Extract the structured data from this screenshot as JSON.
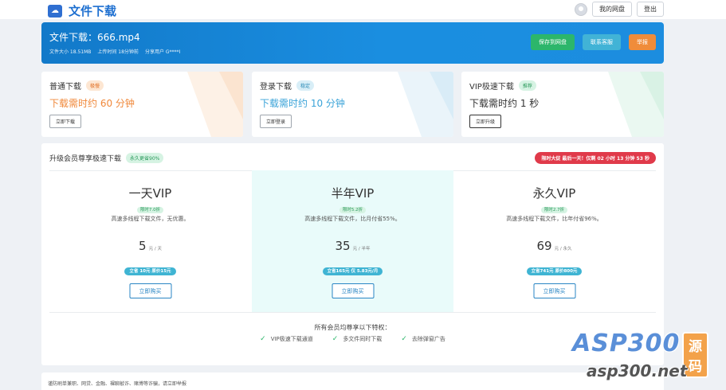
{
  "header": {
    "title": "文件下载",
    "my_disk": "我的网盘",
    "logout": "登出"
  },
  "banner": {
    "title": "文件下载：666.mp4",
    "file_size": "文件大小 18.51MB",
    "upload_time": "上传时间 18分钟前",
    "sharer": "分享用户 G****I",
    "save_label": "保存到网盘",
    "service_label": "联系客服",
    "report_label": "举报",
    "colors": {
      "save": "#2cb66b",
      "service": "#41b3d6",
      "report": "#f08c3a"
    }
  },
  "downloads": [
    {
      "title": "普通下载",
      "tag": "极慢",
      "time": "下载需时约 60 分钟",
      "button": "立即下载",
      "color": "#f0883a"
    },
    {
      "title": "登录下载",
      "tag": "稳定",
      "time": "下载需时约 10 分钟",
      "button": "立即登录",
      "color": "#3aa3d8"
    },
    {
      "title": "VIP极速下载",
      "tag": "推荐",
      "time": "下载需时约 1 秒",
      "button": "立即升级",
      "color": "#333333"
    }
  ],
  "vip": {
    "heading": "升级会员尊享极速下载",
    "heading_tag": "永久更省90%",
    "countdown": "限时大促 最后一天！仅剩 02 小时 13 分钟 53 秒",
    "plans": [
      {
        "name": "一天VIP",
        "discount": "限时7.0折",
        "desc": "高速多线程下载文件，无优惠。",
        "price": "5",
        "unit": "元 / 天",
        "save": "立省 10元 原价15元",
        "buy": "立即购买"
      },
      {
        "name": "半年VIP",
        "discount": "限时5.2折",
        "desc": "高速多线程下载文件，比月付省55%。",
        "price": "35",
        "unit": "元 / 半年",
        "save": "立省165元 仅 5.83元/月",
        "buy": "立即购买"
      },
      {
        "name": "永久VIP",
        "discount": "限时2.7折",
        "desc": "高速多线程下载文件，比年付省96%。",
        "price": "69",
        "unit": "元 / 永久",
        "save": "立省741元 原价800元",
        "buy": "立即购买"
      }
    ],
    "perks_title": "所有会员均尊享以下特权：",
    "perks": [
      "VIP极速下载通道",
      "多文件同时下载",
      "去除弹窗广告"
    ]
  },
  "footer": {
    "notice": "谨防刷单兼职、网贷、金融、裸聊敲诈、赌博等诈骗，请立即举报"
  },
  "watermark": {
    "main": "ASP300",
    "badge": "源码",
    "sub": "asp300.net"
  }
}
